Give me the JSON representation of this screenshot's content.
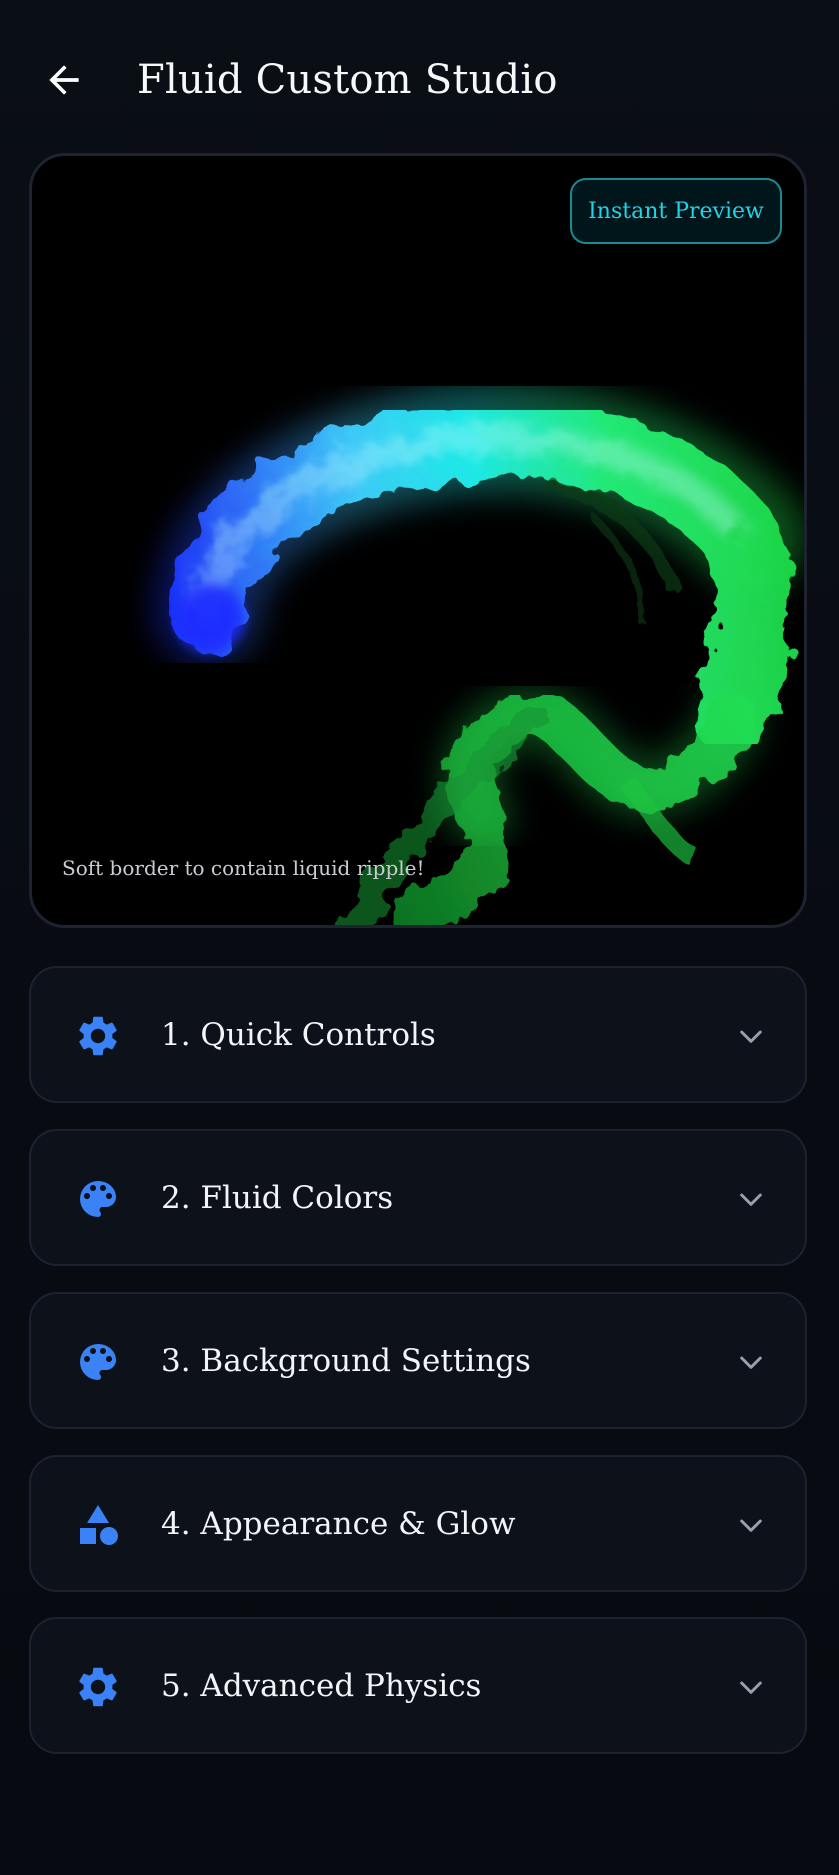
{
  "header": {
    "title": "Fluid Custom Studio",
    "back_icon": "arrow-left-icon"
  },
  "preview": {
    "badge_label": "Instant Preview",
    "caption": "Soft border to contain liquid ripple!",
    "colors": {
      "fluid_start": "#1a3cff",
      "fluid_mid": "#16e6f0",
      "fluid_end": "#1ee65a",
      "background": "#000000"
    }
  },
  "sections": [
    {
      "label": "1. Quick Controls",
      "icon": "gear-icon"
    },
    {
      "label": "2. Fluid Colors",
      "icon": "palette-icon"
    },
    {
      "label": "3. Background Settings",
      "icon": "palette-icon"
    },
    {
      "label": "4. Appearance & Glow",
      "icon": "shapes-icon"
    },
    {
      "label": "5. Advanced Physics",
      "icon": "gear-icon"
    }
  ],
  "theme": {
    "accent": "#3b82f6",
    "cyan": "#22d3e6",
    "background": "#070b12",
    "card": "#0c111a",
    "border": "#1c2230"
  }
}
